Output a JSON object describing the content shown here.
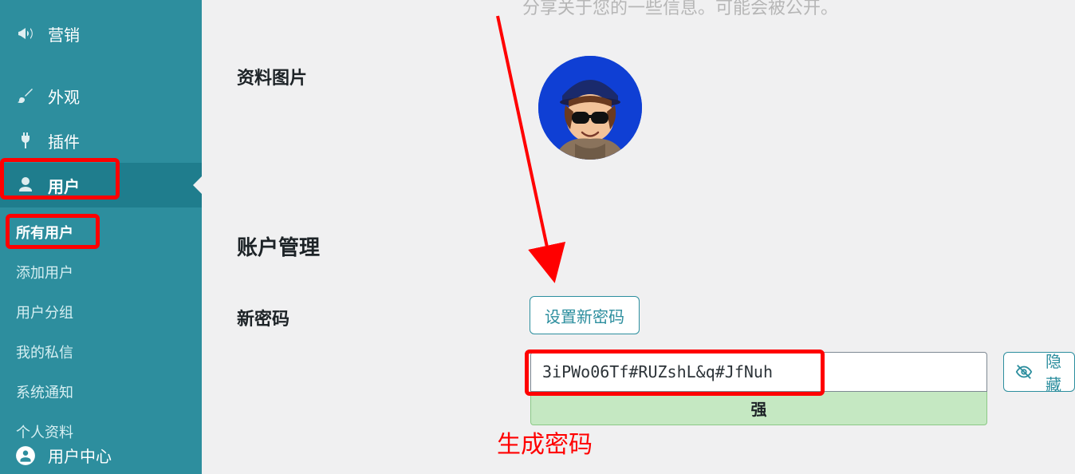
{
  "sidebar": {
    "items": [
      {
        "label": "营销",
        "icon": "megaphone-icon"
      },
      {
        "label": "外观",
        "icon": "brush-icon"
      },
      {
        "label": "插件",
        "icon": "plug-icon"
      },
      {
        "label": "用户",
        "icon": "user-icon",
        "active": true
      }
    ],
    "submenu": [
      {
        "label": "所有用户",
        "current": true
      },
      {
        "label": "添加用户"
      },
      {
        "label": "用户分组"
      },
      {
        "label": "我的私信"
      },
      {
        "label": "系统通知"
      },
      {
        "label": "个人资料"
      }
    ],
    "bottom": {
      "label": "用户中心",
      "icon": "user-center-icon"
    }
  },
  "main": {
    "share_hint": "分享关于您的一些信息。可能会被公开。",
    "labels": {
      "profile_image": "资料图片",
      "account_mgmt": "账户管理",
      "new_password": "新密码"
    },
    "set_password_btn": "设置新密码",
    "password_value": "3iPWo06Tf#RUZshL&q#JfNuh",
    "strength_label": "强",
    "hide_btn_label": "隐藏"
  },
  "annotations": {
    "generate_password": "生成密码"
  }
}
